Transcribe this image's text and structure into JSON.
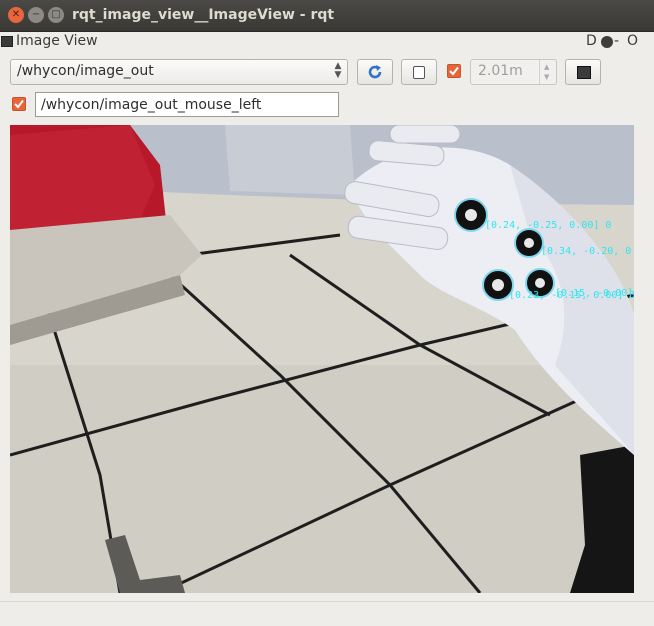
{
  "window": {
    "title": "rqt_image_view__ImageView - rqt",
    "close_glyph": "✕",
    "minimize_glyph": "−",
    "maximize_glyph": "□"
  },
  "dock": {
    "title": "Image View",
    "help_label": "D",
    "close_label": "-",
    "float_label": "O"
  },
  "toolbar": {
    "topic_selected": "/whycon/image_out",
    "zoom_enabled": true,
    "zoom_value": "2.01m"
  },
  "mouse_publish": {
    "enabled": true,
    "topic": "/whycon/image_out_mouse_left"
  },
  "image": {
    "markers": [
      {
        "label": "[0.24, -0.25, 0.00] 0"
      },
      {
        "label": "[0.34, -0.20, 0"
      },
      {
        "label": "[0.23, -0.15, 0.00] 3"
      },
      {
        "label": "[0.15, -0.00] 4"
      }
    ]
  },
  "colors": {
    "accent": "#e6663a",
    "marker_label": "#30e6ef",
    "titlebar": "#3f3e3a"
  },
  "icons": {
    "refresh": "refresh-icon",
    "save": "save-icon",
    "rotate": "rotate-icon",
    "window_icon": "window-icon"
  }
}
